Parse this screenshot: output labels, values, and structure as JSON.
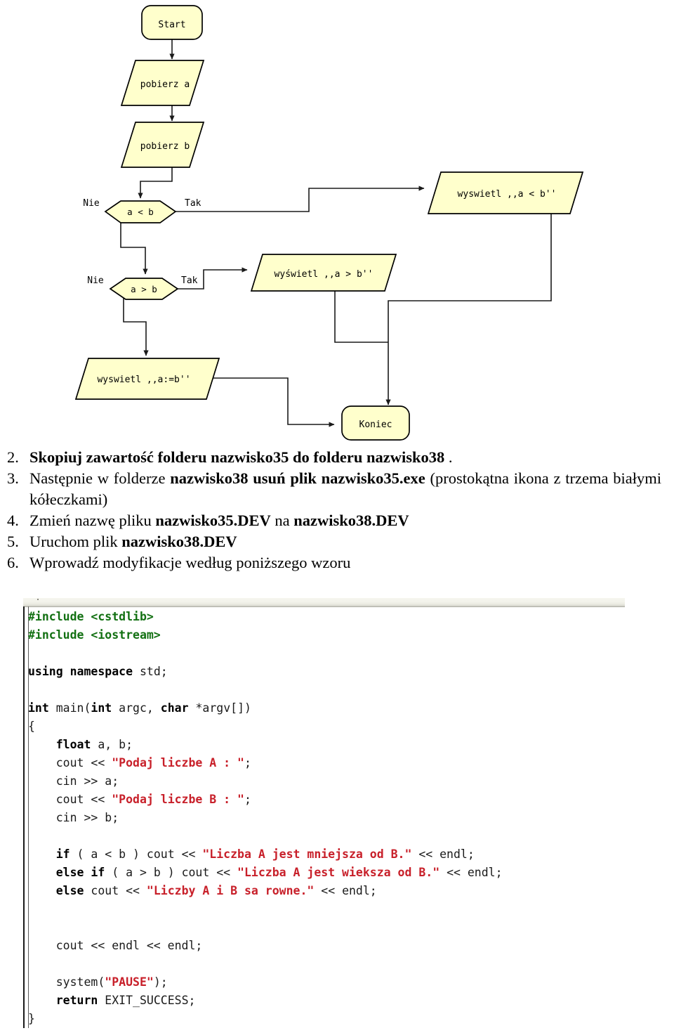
{
  "flowchart": {
    "colors": {
      "node_fill": "#ffffcc",
      "node_stroke": "#000000",
      "edge": "#1a1a1a"
    },
    "nodes": {
      "start": "Start",
      "input_a": "pobierz a",
      "input_b": "pobierz b",
      "decision_lt": "a < b",
      "decision_gt": "a > b",
      "out_lt": "wyswietl ,,a < b''",
      "out_gt": "wyświetl ,,a > b''",
      "out_eq": "wyswietl ,,a:=b''",
      "end": "Koniec"
    },
    "edge_labels": {
      "no1": "Nie",
      "yes1": "Tak",
      "no2": "Nie",
      "yes2": "Tak"
    }
  },
  "instructions": {
    "steps": [
      {
        "marker": "2.",
        "parts": [
          {
            "text": "Skopiuj zawartość folderu nazwisko35 do folderu nazwisko38",
            "bold": true
          },
          {
            "text": " .",
            "bold": false
          }
        ]
      },
      {
        "marker": "3.",
        "parts": [
          {
            "text": "Następnie w folderze ",
            "bold": false
          },
          {
            "text": "nazwisko38 usuń plik nazwisko35.exe",
            "bold": true
          },
          {
            "text": " (prostokątna ikona z trzema białymi kółeczkami)",
            "bold": false
          }
        ]
      },
      {
        "marker": "4.",
        "parts": [
          {
            "text": "Zmień nazwę pliku ",
            "bold": false
          },
          {
            "text": "nazwisko35.DEV",
            "bold": true
          },
          {
            "text": " na ",
            "bold": false
          },
          {
            "text": "nazwisko38.DEV",
            "bold": true
          }
        ]
      },
      {
        "marker": "5.",
        "parts": [
          {
            "text": "Uruchom plik ",
            "bold": false
          },
          {
            "text": "nazwisko38.DEV",
            "bold": true
          }
        ]
      },
      {
        "marker": "6.",
        "parts": [
          {
            "text": "Wprowadź modyfikacje według poniższego wzoru",
            "bold": false
          }
        ]
      }
    ]
  },
  "code": {
    "language": "cpp",
    "colors": {
      "preprocessor": "#127012",
      "string": "#c8202a",
      "keyword": "#000000",
      "plain": "#1a1a1a"
    },
    "lines": [
      [
        {
          "t": "#include <cstdlib>",
          "c": "pre"
        }
      ],
      [
        {
          "t": "#include <iostream>",
          "c": "pre"
        }
      ],
      [
        {
          "t": "",
          "c": "txt"
        }
      ],
      [
        {
          "t": "using namespace",
          "c": "kw"
        },
        {
          "t": " std;",
          "c": "txt"
        }
      ],
      [
        {
          "t": "",
          "c": "txt"
        }
      ],
      [
        {
          "t": "int",
          "c": "kw"
        },
        {
          "t": " main(",
          "c": "txt"
        },
        {
          "t": "int",
          "c": "kw"
        },
        {
          "t": " argc, ",
          "c": "txt"
        },
        {
          "t": "char",
          "c": "kw"
        },
        {
          "t": " *argv[])",
          "c": "txt"
        }
      ],
      [
        {
          "t": "{",
          "c": "txt"
        }
      ],
      [
        {
          "t": "    ",
          "c": "txt"
        },
        {
          "t": "float",
          "c": "kw"
        },
        {
          "t": " a, b;",
          "c": "txt"
        }
      ],
      [
        {
          "t": "    cout << ",
          "c": "txt"
        },
        {
          "t": "\"Podaj liczbe A : \"",
          "c": "str"
        },
        {
          "t": ";",
          "c": "txt"
        }
      ],
      [
        {
          "t": "    cin >> a;",
          "c": "txt"
        }
      ],
      [
        {
          "t": "    cout << ",
          "c": "txt"
        },
        {
          "t": "\"Podaj liczbe B : \"",
          "c": "str"
        },
        {
          "t": ";",
          "c": "txt"
        }
      ],
      [
        {
          "t": "    cin >> b;",
          "c": "txt"
        }
      ],
      [
        {
          "t": "",
          "c": "txt"
        }
      ],
      [
        {
          "t": "    ",
          "c": "txt"
        },
        {
          "t": "if",
          "c": "kw"
        },
        {
          "t": " ( a < b ) cout << ",
          "c": "txt"
        },
        {
          "t": "\"Liczba A jest mniejsza od B.\"",
          "c": "str"
        },
        {
          "t": " << endl;",
          "c": "txt"
        }
      ],
      [
        {
          "t": "    ",
          "c": "txt"
        },
        {
          "t": "else if",
          "c": "kw"
        },
        {
          "t": " ( a > b ) cout << ",
          "c": "txt"
        },
        {
          "t": "\"Liczba A jest wieksza od B.\"",
          "c": "str"
        },
        {
          "t": " << endl;",
          "c": "txt"
        }
      ],
      [
        {
          "t": "    ",
          "c": "txt"
        },
        {
          "t": "else",
          "c": "kw"
        },
        {
          "t": " cout << ",
          "c": "txt"
        },
        {
          "t": "\"Liczby A i B sa rowne.\"",
          "c": "str"
        },
        {
          "t": " << endl;",
          "c": "txt"
        }
      ],
      [
        {
          "t": "",
          "c": "txt"
        }
      ],
      [
        {
          "t": "",
          "c": "txt"
        }
      ],
      [
        {
          "t": "    cout << endl << endl;",
          "c": "txt"
        }
      ],
      [
        {
          "t": "",
          "c": "txt"
        }
      ],
      [
        {
          "t": "    system(",
          "c": "txt"
        },
        {
          "t": "\"PAUSE\"",
          "c": "str"
        },
        {
          "t": ");",
          "c": "txt"
        }
      ],
      [
        {
          "t": "    ",
          "c": "txt"
        },
        {
          "t": "return",
          "c": "kw"
        },
        {
          "t": " EXIT_SUCCESS;",
          "c": "txt"
        }
      ],
      [
        {
          "t": "}",
          "c": "txt"
        }
      ]
    ]
  }
}
